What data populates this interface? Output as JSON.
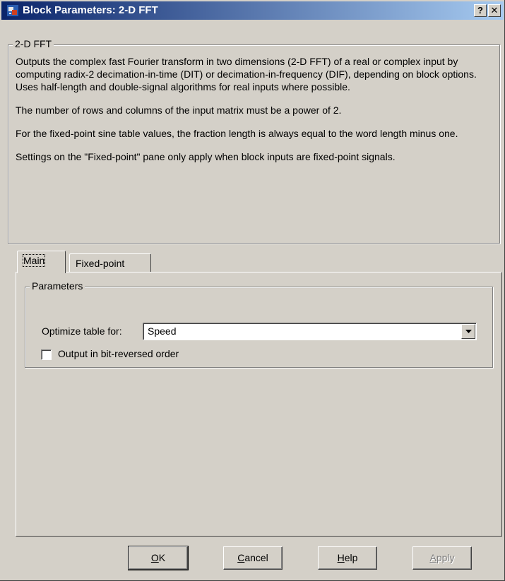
{
  "window": {
    "title": "Block Parameters: 2-D FFT",
    "help_button": "?",
    "close_button": "✕",
    "icon": "simulink-block-icon"
  },
  "description": {
    "group_label": "2-D FFT",
    "paragraphs": [
      "Outputs the complex fast Fourier transform in two dimensions (2-D FFT) of a real or complex input by computing radix-2 decimation-in-time (DIT) or decimation-in-frequency (DIF), depending on block options. Uses half-length and double-signal algorithms for real inputs where possible.",
      "The number of rows and columns of the input matrix must be a power of 2.",
      "For the fixed-point sine table values, the fraction length is always equal to the word length minus one.",
      "Settings on the \"Fixed-point\" pane only apply when block inputs are fixed-point signals."
    ]
  },
  "tabs": [
    {
      "label": "Main",
      "active": true
    },
    {
      "label": "Fixed-point",
      "active": false
    }
  ],
  "parameters": {
    "group_label": "Parameters",
    "optimize_label": "Optimize table for:",
    "optimize_value": "Speed",
    "bit_reversed_label": "Output in bit-reversed order",
    "bit_reversed_checked": false
  },
  "buttons": {
    "ok": {
      "mnemonic": "O",
      "rest": "K"
    },
    "cancel": {
      "mnemonic": "C",
      "rest": "ancel"
    },
    "help": {
      "mnemonic": "H",
      "rest": "elp"
    },
    "apply": {
      "mnemonic": "A",
      "rest": "pply",
      "enabled": false
    }
  }
}
